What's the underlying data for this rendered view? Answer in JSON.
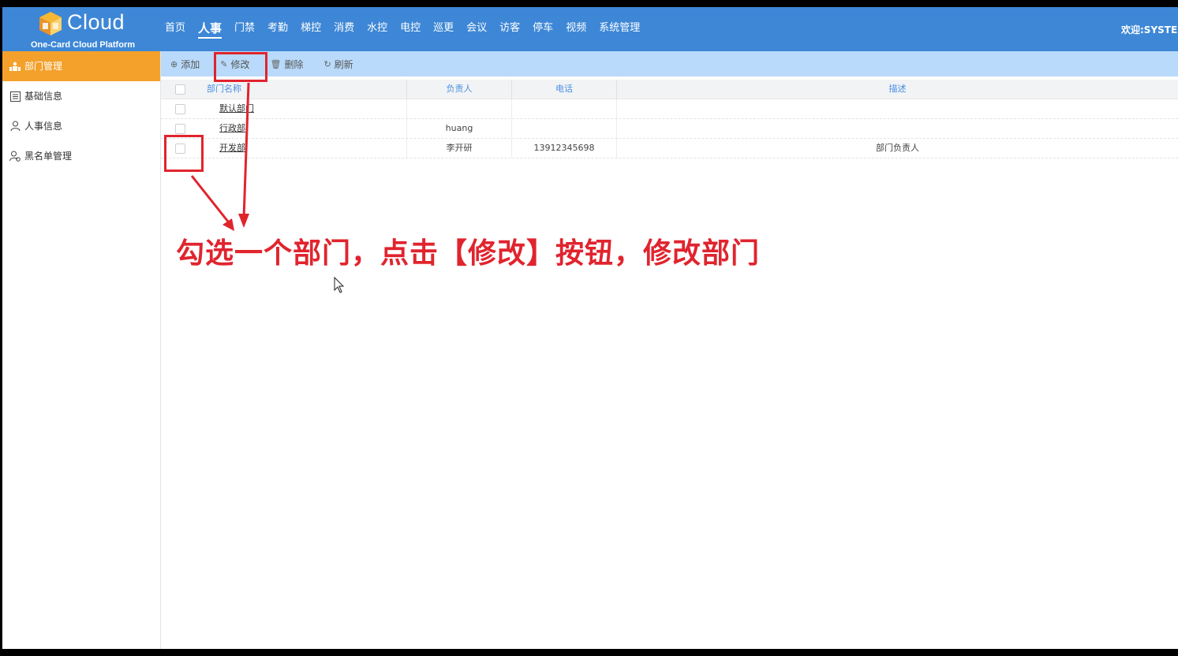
{
  "header": {
    "logo_word": "Cloud",
    "logo_sub": "One-Card Cloud Platform",
    "nav": [
      {
        "label": "首页",
        "active": false
      },
      {
        "label": "人事",
        "active": true
      },
      {
        "label": "门禁",
        "active": false
      },
      {
        "label": "考勤",
        "active": false
      },
      {
        "label": "梯控",
        "active": false
      },
      {
        "label": "消费",
        "active": false
      },
      {
        "label": "水控",
        "active": false
      },
      {
        "label": "电控",
        "active": false
      },
      {
        "label": "巡更",
        "active": false
      },
      {
        "label": "会议",
        "active": false
      },
      {
        "label": "访客",
        "active": false
      },
      {
        "label": "停车",
        "active": false
      },
      {
        "label": "视频",
        "active": false
      },
      {
        "label": "系统管理",
        "active": false
      }
    ],
    "welcome": "欢迎:SYSTEM"
  },
  "sidebar": {
    "items": [
      {
        "label": "部门管理",
        "icon": "department-icon",
        "active": true
      },
      {
        "label": "基础信息",
        "icon": "list-icon",
        "active": false
      },
      {
        "label": "人事信息",
        "icon": "person-icon",
        "active": false
      },
      {
        "label": "黑名单管理",
        "icon": "blacklist-icon",
        "active": false
      }
    ]
  },
  "toolbar": {
    "add": "添加",
    "edit": "修改",
    "delete": "删除",
    "refresh": "刷新"
  },
  "table": {
    "headers": {
      "name": "部门名称",
      "leader": "负责人",
      "phone": "电话",
      "desc": "描述"
    },
    "rows": [
      {
        "name": "默认部门",
        "leader": "",
        "phone": "",
        "desc": ""
      },
      {
        "name": "行政部",
        "leader": "huang",
        "phone": "",
        "desc": ""
      },
      {
        "name": "开发部",
        "leader": "李开研",
        "phone": "13912345698",
        "desc": "部门负责人"
      }
    ]
  },
  "annotation": {
    "text": "勾选一个部门，点击【修改】按钮，修改部门",
    "color": "#e0242e"
  },
  "colors": {
    "header_bg": "#3d87d6",
    "sidebar_active": "#f3a12b",
    "toolbar_bg": "#b9dafa"
  }
}
